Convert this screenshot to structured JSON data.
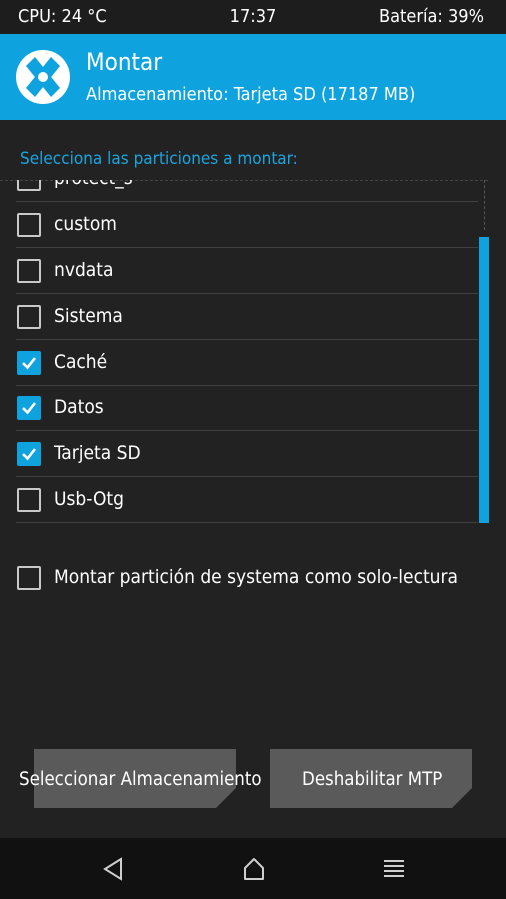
{
  "status_bar": {
    "cpu": "CPU: 24 °C",
    "time": "17:37",
    "battery": "Batería: 39%"
  },
  "header": {
    "title": "Montar",
    "subtitle": "Almacenamiento: Tarjeta SD (17187 MB)"
  },
  "partitions": {
    "title": "Selecciona las particiones a montar:",
    "items": [
      {
        "label": "protect_s",
        "checked": false
      },
      {
        "label": "custom",
        "checked": false
      },
      {
        "label": "nvdata",
        "checked": false
      },
      {
        "label": "Sistema",
        "checked": false
      },
      {
        "label": "Caché",
        "checked": true
      },
      {
        "label": "Datos",
        "checked": true
      },
      {
        "label": "Tarjeta SD",
        "checked": true
      },
      {
        "label": "Usb-Otg",
        "checked": false
      }
    ]
  },
  "readonly_option": {
    "label": "Montar partición de systema como solo-lectura",
    "checked": false
  },
  "buttons": {
    "select_storage": "Seleccionar Almacenamiento",
    "disable_mtp": "Deshabilitar MTP"
  },
  "nav": {
    "back_icon": "back-icon",
    "home_icon": "home-icon",
    "menu_icon": "menu-icon"
  },
  "colors": {
    "accent": "#0ea3df",
    "background": "#222222",
    "button": "#5a5a5a"
  }
}
